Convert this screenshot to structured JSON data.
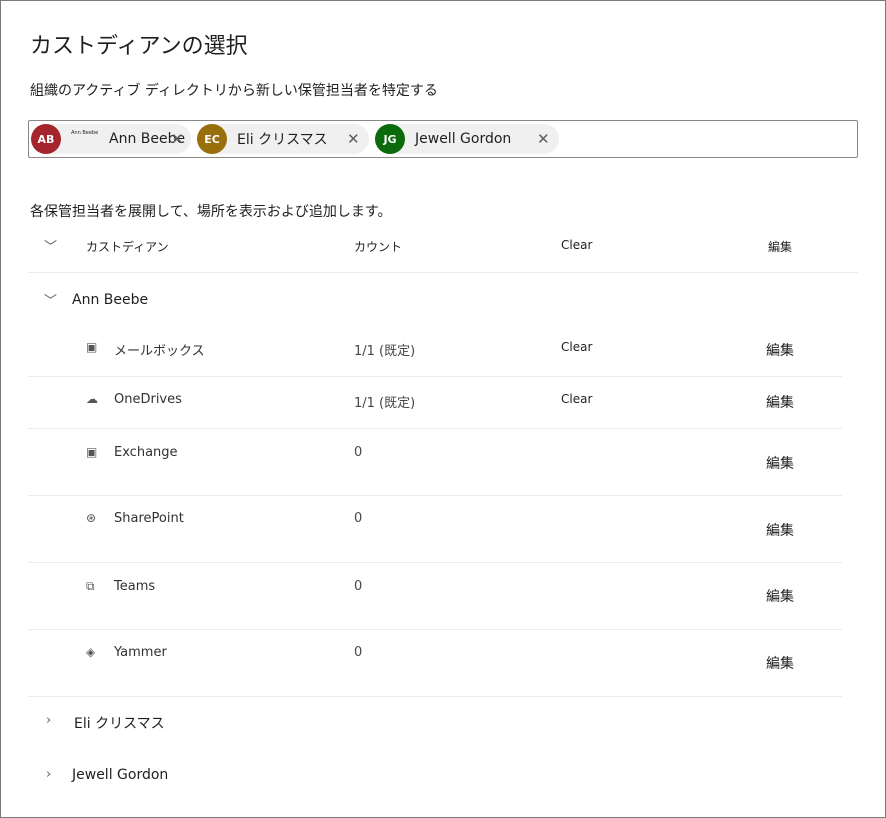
{
  "title": "カストディアンの選択",
  "subtitle": "組織のアクティブ ディレクトリから新しい保管担当者を特定する",
  "picker": {
    "chips": [
      {
        "initials": "AB",
        "name": "Ann Beebe",
        "color": "#a4262c"
      },
      {
        "initials": "EC",
        "name": "Eli クリスマス",
        "color": "#986f0b"
      },
      {
        "initials": "JG",
        "name": "Jewell Gordon",
        "color": "#0b6a0b"
      }
    ]
  },
  "instruction": "各保管担当者を展開して、場所を表示および追加します。",
  "table": {
    "headers": {
      "custodian": "カストディアン",
      "count": "カウント",
      "clear": "Clear",
      "edit": "編集"
    },
    "groups": [
      {
        "name": "Ann Beebe",
        "expanded": true,
        "rows": [
          {
            "icon": "exchange-icon",
            "glyph": "▣",
            "label": "メールボックス",
            "count": "1/1 (既定)",
            "clear": "Clear",
            "edit": "編集"
          },
          {
            "icon": "onedrive-cloud-icon",
            "glyph": "☁",
            "label": "OneDrives",
            "count": "1/1 (既定)",
            "clear": "Clear",
            "edit": "編集"
          },
          {
            "icon": "exchange-icon",
            "glyph": "▣",
            "label": "Exchange",
            "count": "0",
            "edit": "編集"
          },
          {
            "icon": "sharepoint-icon",
            "glyph": "⊛",
            "label": "SharePoint",
            "count": "0",
            "edit": "編集"
          },
          {
            "icon": "teams-icon",
            "glyph": "⧉",
            "label": "Teams",
            "count": "0",
            "edit": "編集"
          },
          {
            "icon": "yammer-icon",
            "glyph": "◈",
            "label": "Yammer",
            "count": "0",
            "edit": "編集"
          }
        ]
      },
      {
        "name": "Eli クリスマス",
        "expanded": false
      },
      {
        "name": "Jewell Gordon",
        "expanded": false
      }
    ]
  }
}
